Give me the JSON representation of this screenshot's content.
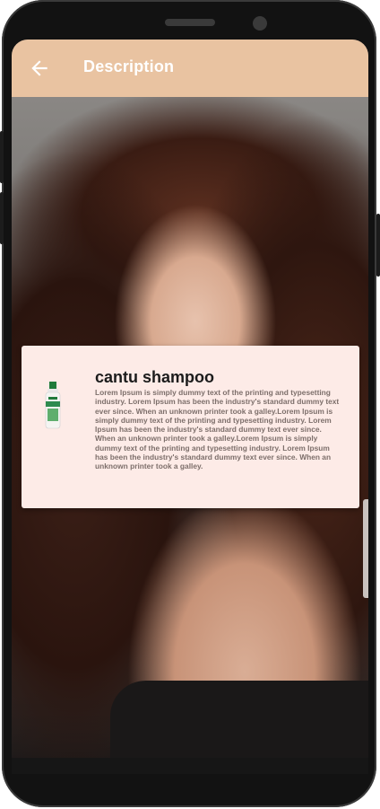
{
  "appbar": {
    "title": "Description",
    "back_icon": "arrow-left-icon"
  },
  "product": {
    "name": "cantu shampoo",
    "image_icon": "shampoo-bottle-icon",
    "description": "Lorem Ipsum is simply dummy text of the printing and typesetting industry. Lorem Ipsum has been the industry's standard dummy text ever since. When an unknown printer took a galley.Lorem Ipsum is simply dummy text of the printing and typesetting industry. Lorem Ipsum has been the industry's standard dummy text ever since. When an unknown printer took a galley.Lorem Ipsum is simply dummy text of the printing and typesetting industry. Lorem Ipsum has been the industry's standard dummy text ever since. When an unknown printer took a galley."
  },
  "colors": {
    "appbar_bg": "#e9c3a1",
    "card_bg": "#fdebe7",
    "title_text": "#ffffff",
    "desc_text": "#7d6f6b"
  }
}
